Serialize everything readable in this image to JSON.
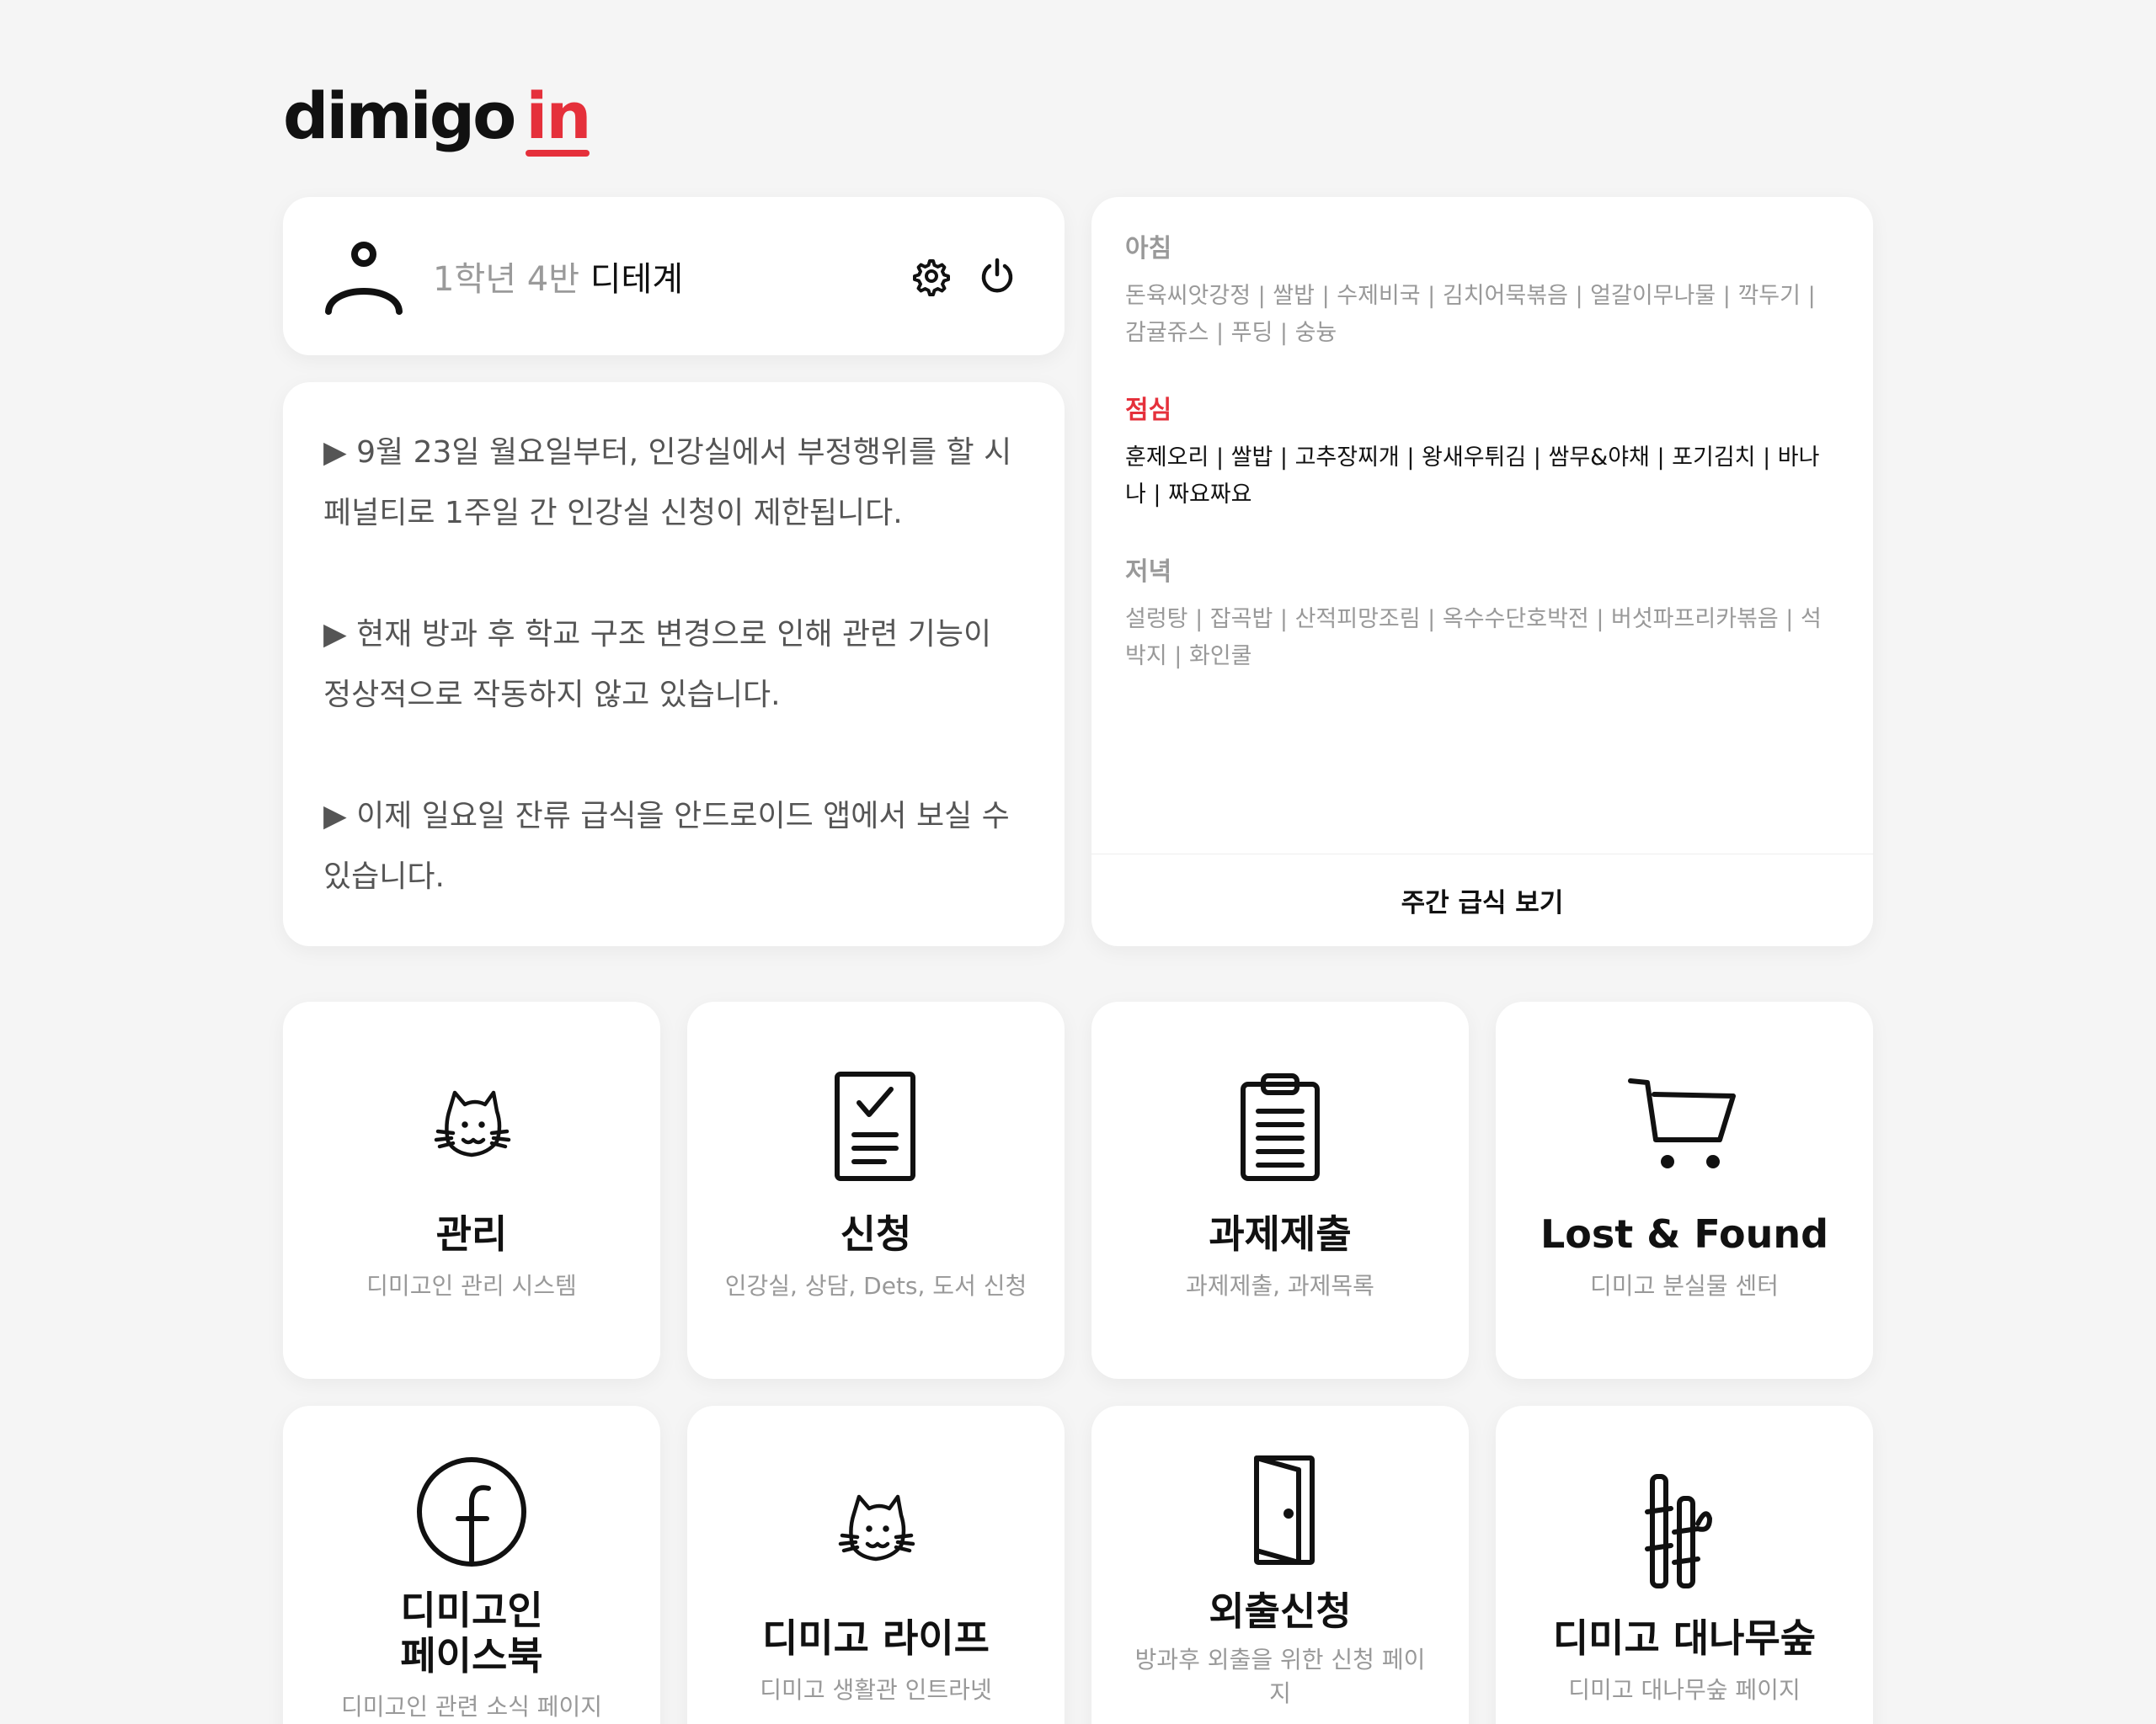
{
  "logo": {
    "main": "dimigo",
    "accent": "in"
  },
  "profile": {
    "class": "1학년 4반",
    "name": "디테계"
  },
  "notices": [
    "▶ 9월 23일 월요일부터, 인강실에서 부정행위를 할 시 페널티로 1주일 간 인강실 신청이 제한됩니다.",
    "▶ 현재 방과 후 학교 구조 변경으로 인해 관련 기능이 정상적으로 작동하지 않고 있습니다.",
    "▶ 이제 일요일 잔류 급식을 안드로이드 앱에서 보실 수 있습니다."
  ],
  "meal": {
    "breakfast": {
      "title": "아침",
      "menu": "돈육씨앗강정 | 쌀밥 | 수제비국 | 김치어묵볶음 | 얼갈이무나물 | 깍두기 | 감귤쥬스 | 푸딩 | 숭늉"
    },
    "lunch": {
      "title": "점심",
      "menu": "훈제오리 | 쌀밥 | 고추장찌개 | 왕새우튀김 | 쌈무&야채 | 포기김치 | 바나나 | 짜요짜요"
    },
    "dinner": {
      "title": "저녁",
      "menu": "설렁탕 | 잡곡밥 | 산적피망조림 | 옥수수단호박전 | 버섯파프리카볶음 | 석박지 | 화인쿨"
    },
    "weekly_label": "주간 급식 보기"
  },
  "services": [
    {
      "title": "관리",
      "desc": "디미고인 관리 시스템",
      "icon": "cat-icon"
    },
    {
      "title": "신청",
      "desc": "인강실, 상담, Dets, 도서 신청",
      "icon": "checklist-icon"
    },
    {
      "title": "과제제출",
      "desc": "과제제출, 과제목록",
      "icon": "clipboard-icon"
    },
    {
      "title": "Lost & Found",
      "desc": "디미고 분실물 센터",
      "icon": "cart-icon"
    },
    {
      "title": "디미고인\n페이스북",
      "desc": "디미고인 관련 소식 페이지",
      "icon": "facebook-icon"
    },
    {
      "title": "디미고 라이프",
      "desc": "디미고 생활관 인트라넷",
      "icon": "cat-icon"
    },
    {
      "title": "외출신청",
      "desc": "방과후 외출을 위한 신청 페이지",
      "icon": "door-icon"
    },
    {
      "title": "디미고 대나무숲",
      "desc": "디미고 대나무숲 페이지",
      "icon": "bamboo-icon"
    }
  ],
  "colors": {
    "accent": "#e5303b",
    "background": "#f5f5f5",
    "muted": "#999999"
  }
}
